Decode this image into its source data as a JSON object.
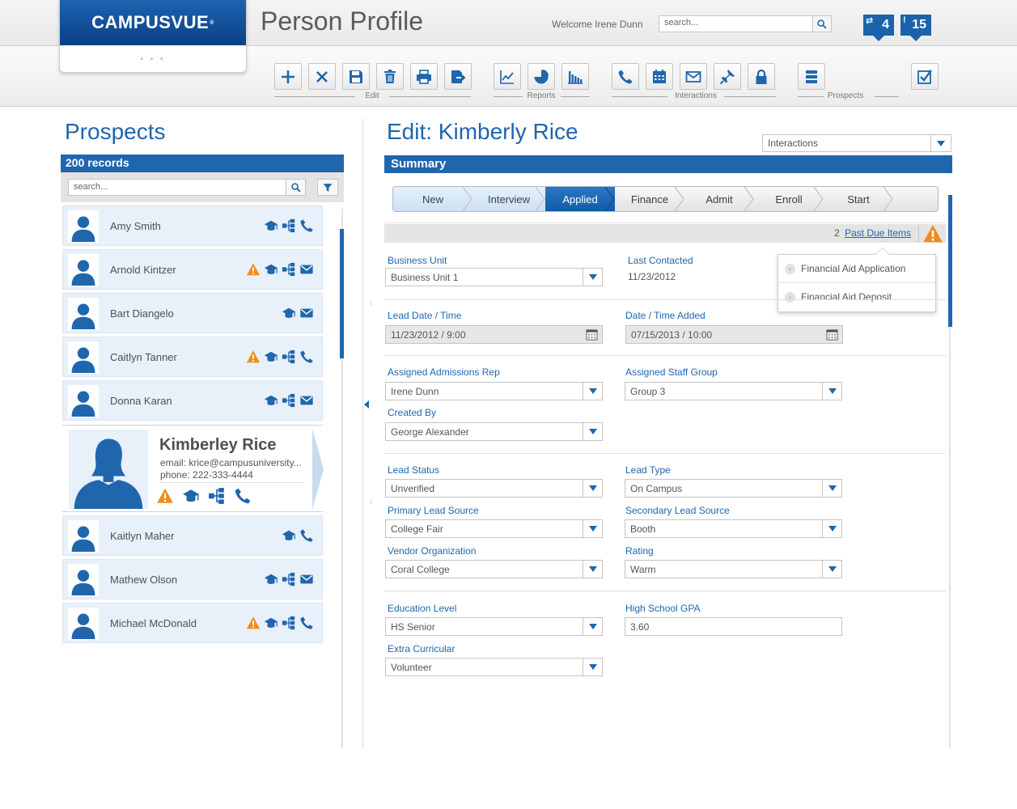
{
  "header": {
    "brand_text": "CAMPUSVUE",
    "brand_mark": "®",
    "logo_dots": "• • •",
    "page_title": "Person Profile",
    "welcome": "Welcome Irene Dunn",
    "search_placeholder": "search...",
    "badge_sync_count": "4",
    "badge_alert_count": "15"
  },
  "toolbar": {
    "groups": [
      "Edit",
      "Reports",
      "Interactions",
      "Prospects"
    ],
    "buttons": {
      "add": "plus-icon",
      "delete": "x-icon",
      "save": "save-icon",
      "trash": "trash-icon",
      "print": "print-icon",
      "export": "export-icon",
      "line_chart": "line-chart-icon",
      "pie_chart": "pie-chart-icon",
      "bar_chart": "bar-chart-icon",
      "phone": "phone-icon",
      "calendar": "calendar-icon",
      "mail": "mail-icon",
      "pin": "pin-icon",
      "lock": "lock-icon",
      "list": "list-icon",
      "checkbox": "checkbox-icon"
    }
  },
  "prospects": {
    "title": "Prospects",
    "record_count": "200 records",
    "search_placeholder": "search...",
    "items": [
      {
        "name": "Amy Smith",
        "icons": [
          "grad",
          "tree",
          "phone"
        ]
      },
      {
        "name": "Arnold Kintzer",
        "icons": [
          "warn",
          "grad",
          "tree",
          "mail"
        ]
      },
      {
        "name": "Bart Diangelo",
        "icons": [
          "grad",
          "mail"
        ]
      },
      {
        "name": "Caitlyn Tanner",
        "icons": [
          "warn",
          "grad",
          "tree",
          "phone"
        ]
      },
      {
        "name": "Donna Karan",
        "icons": [
          "grad",
          "tree",
          "mail"
        ]
      },
      {
        "name": "Kaitlyn Maher",
        "icons": [
          "grad",
          "phone"
        ]
      },
      {
        "name": "Mathew Olson",
        "icons": [
          "grad",
          "tree",
          "mail"
        ]
      },
      {
        "name": "Michael McDonald",
        "icons": [
          "warn",
          "grad",
          "tree",
          "phone"
        ]
      }
    ],
    "selected": {
      "name": "Kimberley Rice",
      "email": "email: krice@campusuniversity...",
      "phone": "phone: 222-333-4444"
    }
  },
  "edit": {
    "title": "Edit: Kimberly Rice",
    "view_select": "Interactions",
    "summary_label": "Summary",
    "stages": [
      "New",
      "Interview",
      "Applied",
      "Finance",
      "Admit",
      "Enroll",
      "Start"
    ],
    "current_stage": "Applied",
    "past_due_count": "2",
    "past_due_label": "Past Due Items",
    "past_due_items": [
      "Financial Aid Application",
      "Financial Aid Deposit"
    ]
  },
  "form": {
    "business_unit_label": "Business Unit",
    "business_unit": "Business Unit 1",
    "last_contacted_label": "Last Contacted",
    "last_contacted": "11/23/2012",
    "lead_date_label": "Lead Date / Time",
    "lead_date": "11/23/2012  /  9:00",
    "date_added_label": "Date / Time Added",
    "date_added": "07/15/2013  /  10:00",
    "admissions_rep_label": "Assigned Admissions Rep",
    "admissions_rep": "Irene Dunn",
    "staff_group_label": "Assigned Staff Group",
    "staff_group": "Group 3",
    "created_by_label": "Created By",
    "created_by": "George Alexander",
    "lead_status_label": "Lead Status",
    "lead_status": "Unverified",
    "lead_type_label": "Lead Type",
    "lead_type": "On Campus",
    "primary_source_label": "Primary Lead Source",
    "primary_source": "College Fair",
    "secondary_source_label": "Secondary Lead Source",
    "secondary_source": "Booth",
    "vendor_label": "Vendor Organization",
    "vendor": "Coral College",
    "rating_label": "Rating",
    "rating": "Warm",
    "education_label": "Education Level",
    "education": "HS Senior",
    "gpa_label": "High School GPA",
    "gpa": "3.60",
    "extra_label": "Extra Curricular",
    "extra": "Volunteer"
  },
  "colors": {
    "brand_blue": "#1f66ad",
    "warning_orange": "#f28c1e",
    "row_background": "#e8f0fa"
  }
}
